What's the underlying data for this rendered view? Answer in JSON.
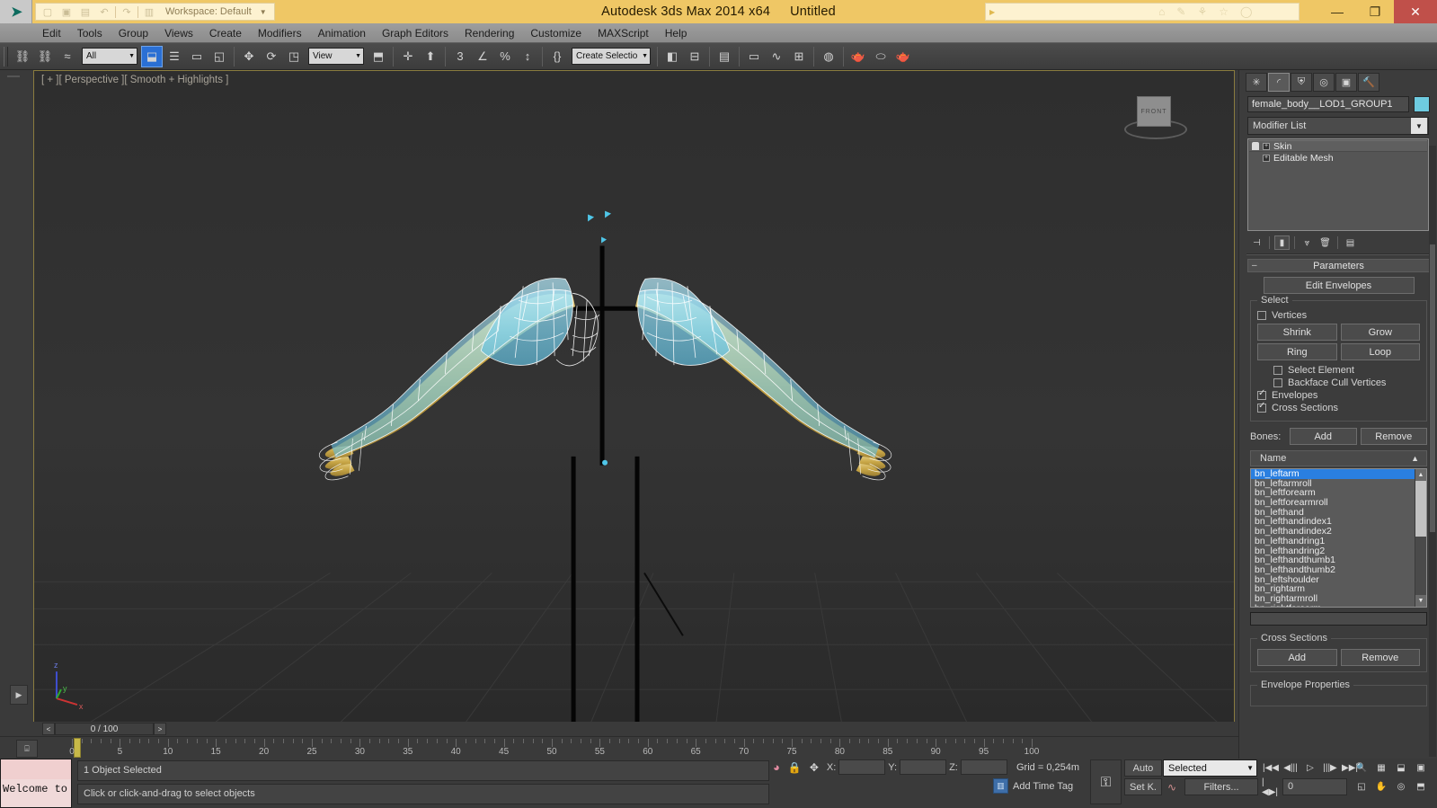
{
  "titlebar": {
    "app_title": "Autodesk 3ds Max  2014 x64",
    "document_title": "Untitled",
    "workspace_label": "Workspace: Default",
    "minimize": "—",
    "maximize": "❐",
    "close": "✕",
    "accent_color": "#efc765",
    "close_color": "#c0504a"
  },
  "menubar": {
    "items": [
      {
        "label": "Edit"
      },
      {
        "label": "Tools"
      },
      {
        "label": "Group"
      },
      {
        "label": "Views"
      },
      {
        "label": "Create"
      },
      {
        "label": "Modifiers"
      },
      {
        "label": "Animation"
      },
      {
        "label": "Graph Editors"
      },
      {
        "label": "Rendering"
      },
      {
        "label": "Customize"
      },
      {
        "label": "MAXScript"
      },
      {
        "label": "Help"
      }
    ]
  },
  "toolbar": {
    "selection_filter": "All",
    "reference_coordinate": "View",
    "named_selection_set": "Create Selection Se",
    "buttons": [
      {
        "name": "select-and-link",
        "glyph": "⛓"
      },
      {
        "name": "unlink-selection",
        "glyph": "⛓"
      },
      {
        "name": "bind-to-space-warp",
        "glyph": "≈"
      },
      {
        "name": "select-object",
        "glyph": "⬓"
      },
      {
        "name": "select-by-name",
        "glyph": "☰"
      },
      {
        "name": "rectangular-selection-region",
        "glyph": "▭"
      },
      {
        "name": "window-crossing",
        "glyph": "◱"
      },
      {
        "name": "select-and-move",
        "glyph": "✥"
      },
      {
        "name": "select-and-rotate",
        "glyph": "⟳"
      },
      {
        "name": "select-and-scale",
        "glyph": "◳"
      },
      {
        "name": "use-center-flyout",
        "glyph": "⬒"
      },
      {
        "name": "select-and-manipulate",
        "glyph": "✛"
      },
      {
        "name": "snaps-toggle-3d",
        "glyph": "3"
      },
      {
        "name": "angle-snap-toggle",
        "glyph": "∠"
      },
      {
        "name": "percent-snap-toggle",
        "glyph": "%"
      },
      {
        "name": "spinner-snap-toggle",
        "glyph": "↕"
      },
      {
        "name": "edit-named-selection-sets",
        "glyph": "{}"
      },
      {
        "name": "mirror",
        "glyph": "◧"
      },
      {
        "name": "align",
        "glyph": "⊟"
      },
      {
        "name": "layer-manager",
        "glyph": "▤"
      },
      {
        "name": "graphite-modeling-tools",
        "glyph": "▭"
      },
      {
        "name": "curve-editor",
        "glyph": "∿"
      },
      {
        "name": "schematic-view",
        "glyph": "⊞"
      },
      {
        "name": "material-editor",
        "glyph": "◍"
      },
      {
        "name": "render-setup",
        "glyph": "🫖"
      },
      {
        "name": "rendered-frame-window",
        "glyph": "⬭"
      },
      {
        "name": "render-production",
        "glyph": "🫖"
      }
    ]
  },
  "viewport": {
    "label": "[ + ][ Perspective ][ Smooth + Highlights ]",
    "viewcube_face": "FRONT",
    "axis_labels": {
      "z": "z",
      "y": "y",
      "x": "x"
    },
    "background_color": "#2b2b2b",
    "mesh_color": "#c9a94e",
    "envelope_color": "#7fd4ef"
  },
  "timebar": {
    "prev_arrow": "<",
    "next_arrow": ">",
    "frame_display": "0 / 100",
    "ticks": [
      0,
      5,
      10,
      15,
      20,
      25,
      30,
      35,
      40,
      45,
      50,
      55,
      60,
      65,
      70,
      75,
      80,
      85,
      90,
      95,
      100
    ]
  },
  "statusbar": {
    "maxlog_text": "Welcome to",
    "object_status": "1 Object Selected",
    "prompt": "Click or click-and-drag to select objects",
    "coord_x_label": "X:",
    "coord_y_label": "Y:",
    "coord_z_label": "Z:",
    "coord_x_value": "",
    "coord_y_value": "",
    "coord_z_value": "",
    "grid_text": "Grid = 0,254m",
    "add_time_tag": "Add Time Tag",
    "auto_key": "Auto",
    "set_key": "Set K.",
    "key_filter": "Selected",
    "filters_button": "Filters...",
    "current_frame": "0",
    "playback_buttons": [
      {
        "name": "go-to-start",
        "glyph": "|◀◀"
      },
      {
        "name": "previous-frame",
        "glyph": "◀|||"
      },
      {
        "name": "play-animation",
        "glyph": "▷"
      },
      {
        "name": "next-frame",
        "glyph": "|||▶"
      },
      {
        "name": "go-to-end",
        "glyph": "▶▶|"
      }
    ],
    "viewport_nav_buttons": [
      {
        "name": "zoom-tool",
        "glyph": "🔍"
      },
      {
        "name": "zoom-all",
        "glyph": "▦"
      },
      {
        "name": "zoom-extents",
        "glyph": "⬓"
      },
      {
        "name": "zoom-extents-all",
        "glyph": "▣"
      },
      {
        "name": "field-of-view",
        "glyph": "◱"
      },
      {
        "name": "pan-view",
        "glyph": "✋"
      },
      {
        "name": "orbit",
        "glyph": "◎"
      },
      {
        "name": "maximize-viewport-toggle",
        "glyph": "⬒"
      }
    ]
  },
  "command_panel": {
    "tabs": [
      {
        "name": "create",
        "glyph": "✳",
        "active": false
      },
      {
        "name": "modify",
        "glyph": "◜",
        "active": true
      },
      {
        "name": "hierarchy",
        "glyph": "⛨",
        "active": false
      },
      {
        "name": "motion",
        "glyph": "◎",
        "active": false
      },
      {
        "name": "display",
        "glyph": "▣",
        "active": false
      },
      {
        "name": "utilities",
        "glyph": "🔨",
        "active": false
      }
    ],
    "object_name": "female_body__LOD1_GROUP1",
    "object_color": "#6ecbe0",
    "modifier_list_label": "Modifier List",
    "stack": [
      {
        "label": "Skin",
        "selected": true
      },
      {
        "label": "Editable Mesh",
        "selected": false
      }
    ],
    "stack_tools": [
      {
        "name": "pin-stack-icon",
        "glyph": "⊣",
        "boxed": false
      },
      {
        "name": "show-end-result-icon",
        "glyph": "▮",
        "boxed": true
      },
      {
        "name": "make-unique-icon",
        "glyph": "⩔",
        "boxed": false
      },
      {
        "name": "remove-modifier-icon",
        "glyph": "🗑",
        "boxed": false
      },
      {
        "name": "configure-modifier-sets-icon",
        "glyph": "▤",
        "boxed": false
      }
    ],
    "parameters": {
      "rollout_title": "Parameters",
      "edit_envelopes": "Edit Envelopes",
      "select_group_title": "Select",
      "vertices_label": "Vertices",
      "vertices_checked": false,
      "shrink": "Shrink",
      "grow": "Grow",
      "ring": "Ring",
      "loop": "Loop",
      "select_element_label": "Select Element",
      "select_element_checked": false,
      "backface_cull_label": "Backface Cull Vertices",
      "backface_cull_checked": false,
      "envelopes_label": "Envelopes",
      "envelopes_checked": true,
      "cross_sections_label": "Cross Sections",
      "cross_sections_checked": true,
      "bones_label": "Bones:",
      "bones_add": "Add",
      "bones_remove": "Remove",
      "list_header_name": "Name",
      "bone_list": [
        {
          "label": "bn_leftarm",
          "selected": true
        },
        {
          "label": "bn_leftarmroll",
          "selected": false
        },
        {
          "label": "bn_leftforearm",
          "selected": false
        },
        {
          "label": "bn_leftforearmroll",
          "selected": false
        },
        {
          "label": "bn_lefthand",
          "selected": false
        },
        {
          "label": "bn_lefthandindex1",
          "selected": false
        },
        {
          "label": "bn_lefthandindex2",
          "selected": false
        },
        {
          "label": "bn_lefthandring1",
          "selected": false
        },
        {
          "label": "bn_lefthandring2",
          "selected": false
        },
        {
          "label": "bn_lefthandthumb1",
          "selected": false
        },
        {
          "label": "bn_lefthandthumb2",
          "selected": false
        },
        {
          "label": "bn_leftshoulder",
          "selected": false
        },
        {
          "label": "bn_rightarm",
          "selected": false
        },
        {
          "label": "bn_rightarmroll",
          "selected": false
        },
        {
          "label": "bn_rightforearm",
          "selected": false
        }
      ],
      "cross_sections_group_title": "Cross Sections",
      "cs_add": "Add",
      "cs_remove": "Remove",
      "envelope_properties_title": "Envelope Properties"
    }
  }
}
